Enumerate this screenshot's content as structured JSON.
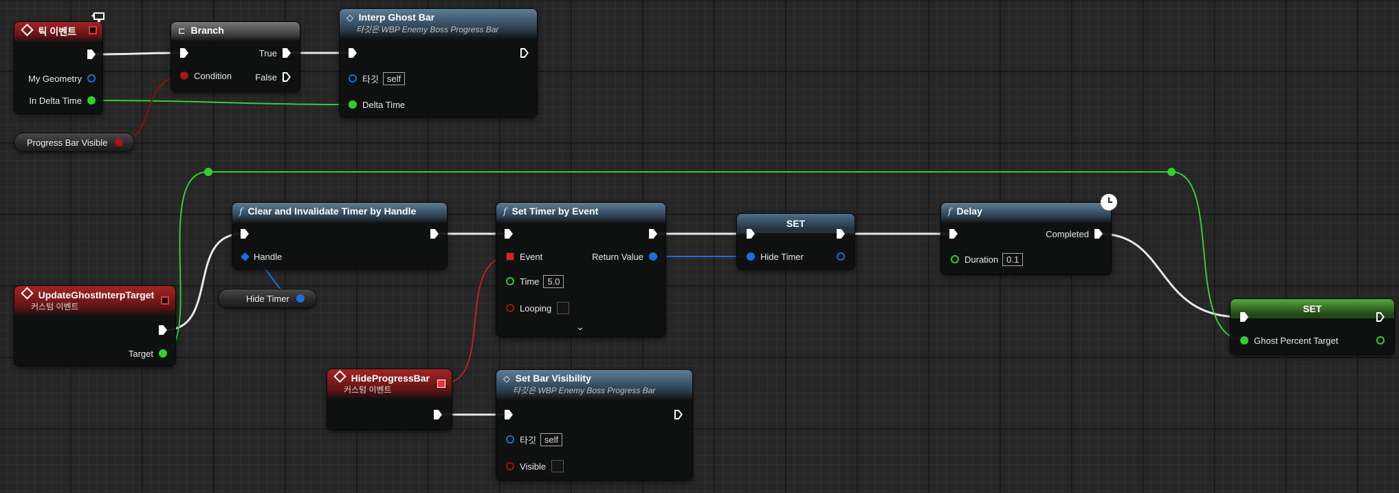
{
  "nodes": {
    "tick_event": {
      "title": "틱 이벤트",
      "pins": {
        "geometry": "My Geometry",
        "delta": "In Delta Time"
      }
    },
    "branch": {
      "title": "Branch",
      "pins": {
        "condition": "Condition",
        "true": "True",
        "false": "False"
      }
    },
    "interp_ghost_bar": {
      "title": "Interp Ghost Bar",
      "subtitle": "타깃은 WBP Enemy Boss Progress Bar",
      "pins": {
        "target": "타깃",
        "target_value": "self",
        "delta": "Delta Time"
      }
    },
    "progress_bar_visible": {
      "label": "Progress Bar Visible"
    },
    "clear_timer": {
      "title": "Clear and Invalidate Timer by Handle",
      "pins": {
        "handle": "Handle"
      }
    },
    "hide_timer_var": {
      "label": "Hide Timer"
    },
    "update_ghost": {
      "title": "UpdateGhostInterpTarget",
      "subtitle": "커스텀 이벤트",
      "pins": {
        "target": "Target"
      }
    },
    "set_timer": {
      "title": "Set Timer by Event",
      "pins": {
        "event": "Event",
        "return_value": "Return Value",
        "time": "Time",
        "time_value": "5.0",
        "looping": "Looping"
      }
    },
    "set_hide_timer": {
      "title": "SET",
      "pins": {
        "hide_timer": "Hide Timer"
      }
    },
    "delay": {
      "title": "Delay",
      "pins": {
        "completed": "Completed",
        "duration": "Duration",
        "duration_value": "0.1"
      }
    },
    "set_ghost": {
      "title": "SET",
      "pins": {
        "ghost": "Ghost Percent Target"
      }
    },
    "hide_progress_bar": {
      "title": "HideProgressBar",
      "subtitle": "커스텀 이벤트"
    },
    "set_bar_visibility": {
      "title": "Set Bar Visibility",
      "subtitle": "타깃은 WBP Enemy Boss Progress Bar",
      "pins": {
        "target": "타깃",
        "target_value": "self",
        "visible": "Visible"
      }
    }
  },
  "colors": {
    "exec": "#ffffff",
    "float": "#2fd12f",
    "bool": "#a11313",
    "struct": "#1a6fe0",
    "delegate": "#e53434",
    "function_header": "#5c7e98",
    "event_header": "#a42424"
  },
  "icons": {
    "event": "event-diamond-icon",
    "function": "function-f-icon",
    "branch": "branch-icon",
    "latent": "clock-icon",
    "editor": "monitor-icon"
  }
}
